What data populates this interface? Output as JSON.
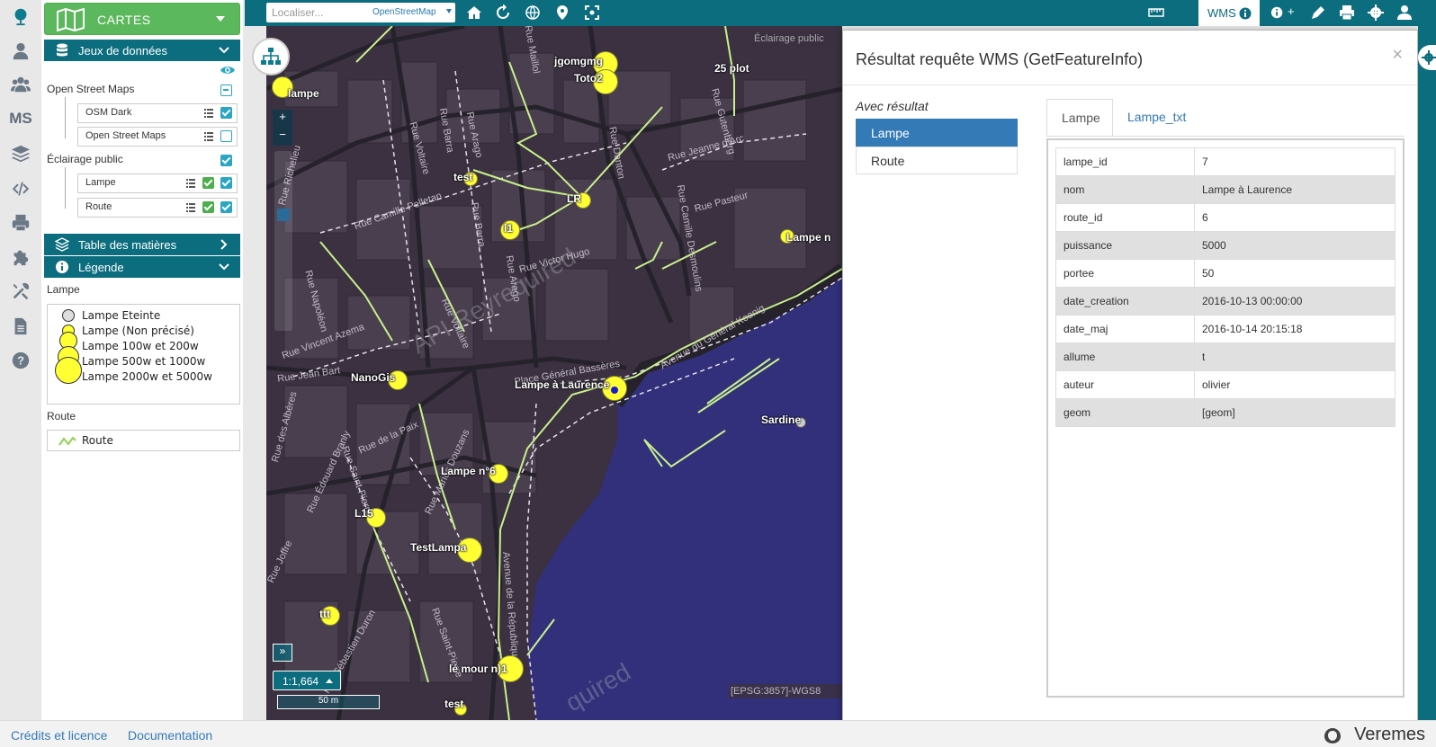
{
  "panel": {
    "cartes_label": "CARTES",
    "datasets_header": "Jeux de données",
    "groups": [
      {
        "label": "Open Street Maps",
        "layers": [
          {
            "label": "OSM Dark"
          },
          {
            "label": "Open Street Maps"
          }
        ]
      },
      {
        "label": "Éclairage public",
        "layers": [
          {
            "label": "Lampe"
          },
          {
            "label": "Route"
          }
        ]
      }
    ],
    "toc_header": "Table des matières",
    "legend_header": "Légende",
    "legend": {
      "lampe_title": "Lampe",
      "lampe_items": [
        "Lampe Eteinte",
        "Lampe (Non précisé)",
        "Lampe 100w et 200w",
        "Lampe 500w et 1000w",
        "Lampe 2000w et 5000w"
      ],
      "route_title": "Route",
      "route_item": "Route"
    }
  },
  "rail": {
    "ms_label": "MS"
  },
  "toolbar": {
    "search_placeholder": "Localiser...",
    "provider": "OpenStreetMap",
    "wms_label": "WMS",
    "info_plus": "+"
  },
  "map": {
    "attribution": "Éclairage public",
    "scale_ratio": "1:1,664",
    "scale_bar": "50 m",
    "epsg": "[EPSG:3857]-WGS8",
    "watermark": "API Reyrequired",
    "watermark2": "quired",
    "lamp_labels": [
      "jgomgmg",
      "Toto2",
      "25 plot",
      "lampe",
      "test",
      "LR",
      "l1",
      "Lampe n",
      "NanoGis",
      "Lampe à Laurence",
      "Sardine",
      "Lampe n°6",
      "L15",
      "TestLampa",
      "ttt",
      "lé mour n)1",
      "test"
    ],
    "streets": [
      "Rue Voltaire",
      "Rue Barra",
      "Rue Arago",
      "Rue Danton",
      "Rue Jeanne d'Arc",
      "Rue Camille Pelletan",
      "Rue Barra",
      "Rue Arago",
      "Rue Victor Hugo",
      "Rue Pasteur",
      "Rue Camille Desmoulins",
      "Rue Napoléon",
      "Rue Voltaire",
      "Rue Vincent Azema",
      "Rue Jean Bart",
      "Rue des Albères",
      "Rue Édouard Branly",
      "Rue de la Paix",
      "Rue Marius Douzans",
      "Place Général Bassères",
      "Avenue du Général Koenig",
      "Rue Saint-Pierre",
      "Rue Joffre",
      "Avenue de la République",
      "Rue Saint-Pierre",
      "Rue Sébastien Duron",
      "Rue Gutenberg",
      "Rue Maillol",
      "Rue Richelieu"
    ]
  },
  "dialog": {
    "title": "Résultat requête WMS (GetFeatureInfo)",
    "close": "×",
    "avec_resultat": "Avec résultat",
    "results": [
      "Lampe",
      "Route"
    ],
    "tabs": [
      "Lampe",
      "Lampe_txt"
    ],
    "attributes": [
      {
        "key": "lampe_id",
        "value": "7"
      },
      {
        "key": "nom",
        "value": "Lampe à Laurence"
      },
      {
        "key": "route_id",
        "value": "6"
      },
      {
        "key": "puissance",
        "value": "5000"
      },
      {
        "key": "portee",
        "value": "50"
      },
      {
        "key": "date_creation",
        "value": "2016-10-13 00:00:00"
      },
      {
        "key": "date_maj",
        "value": "2016-10-14 20:15:18"
      },
      {
        "key": "allume",
        "value": "t"
      },
      {
        "key": "auteur",
        "value": "olivier"
      },
      {
        "key": "geom",
        "value": "[geom]"
      }
    ]
  },
  "footer": {
    "credits": "Crédits et licence",
    "documentation": "Documentation",
    "brand": "Veremes"
  },
  "colors": {
    "teal": "#0c6d7f",
    "green": "#5cb85c",
    "lamp": "#ffff33",
    "road": "#c8f08c",
    "water": "#32307a",
    "land": "#3b3140"
  }
}
